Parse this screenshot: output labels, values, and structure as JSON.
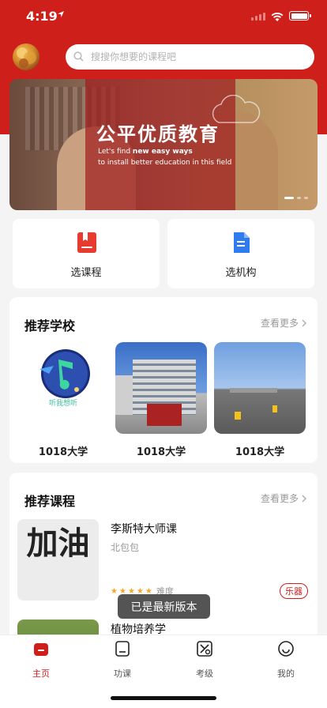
{
  "status_bar": {
    "time": "4:19",
    "location_icon": "location-arrow-icon"
  },
  "header": {
    "search_placeholder": "搜搜你想要的课程吧",
    "avatar": "avatar-image"
  },
  "banner": {
    "title": "公平优质教育",
    "subtitle_line1_prefix": "Let's find ",
    "subtitle_line1_bold": "new easy ways",
    "subtitle_line2": "to install better education in this field"
  },
  "quick_actions": [
    {
      "label": "选课程",
      "icon": "bookmark-book-icon",
      "color": "#e63b2e"
    },
    {
      "label": "选机构",
      "icon": "building-icon",
      "color": "#2f7cf0"
    }
  ],
  "schools": {
    "title": "推荐学校",
    "more": "查看更多",
    "items": [
      {
        "name": "1018大学",
        "logo_caption": "听我想听"
      },
      {
        "name": "1018大学"
      },
      {
        "name": "1018大学"
      }
    ]
  },
  "courses": {
    "title": "推荐课程",
    "more": "查看更多",
    "items": [
      {
        "title": "李斯特大师课",
        "org": "北包包",
        "rating": 5,
        "difficulty_label": "难度",
        "tag": "乐器",
        "image_text": "加油"
      },
      {
        "title": "植物培养学"
      }
    ]
  },
  "toast": "已是最新版本",
  "tabbar": [
    {
      "label": "主页",
      "icon": "home-icon",
      "active": true
    },
    {
      "label": "功课",
      "icon": "homework-icon",
      "active": false
    },
    {
      "label": "考级",
      "icon": "exam-icon",
      "active": false
    },
    {
      "label": "我的",
      "icon": "profile-smile-icon",
      "active": false
    }
  ],
  "colors": {
    "brand_red": "#cf1f1a",
    "background": "#f4f4f4"
  }
}
